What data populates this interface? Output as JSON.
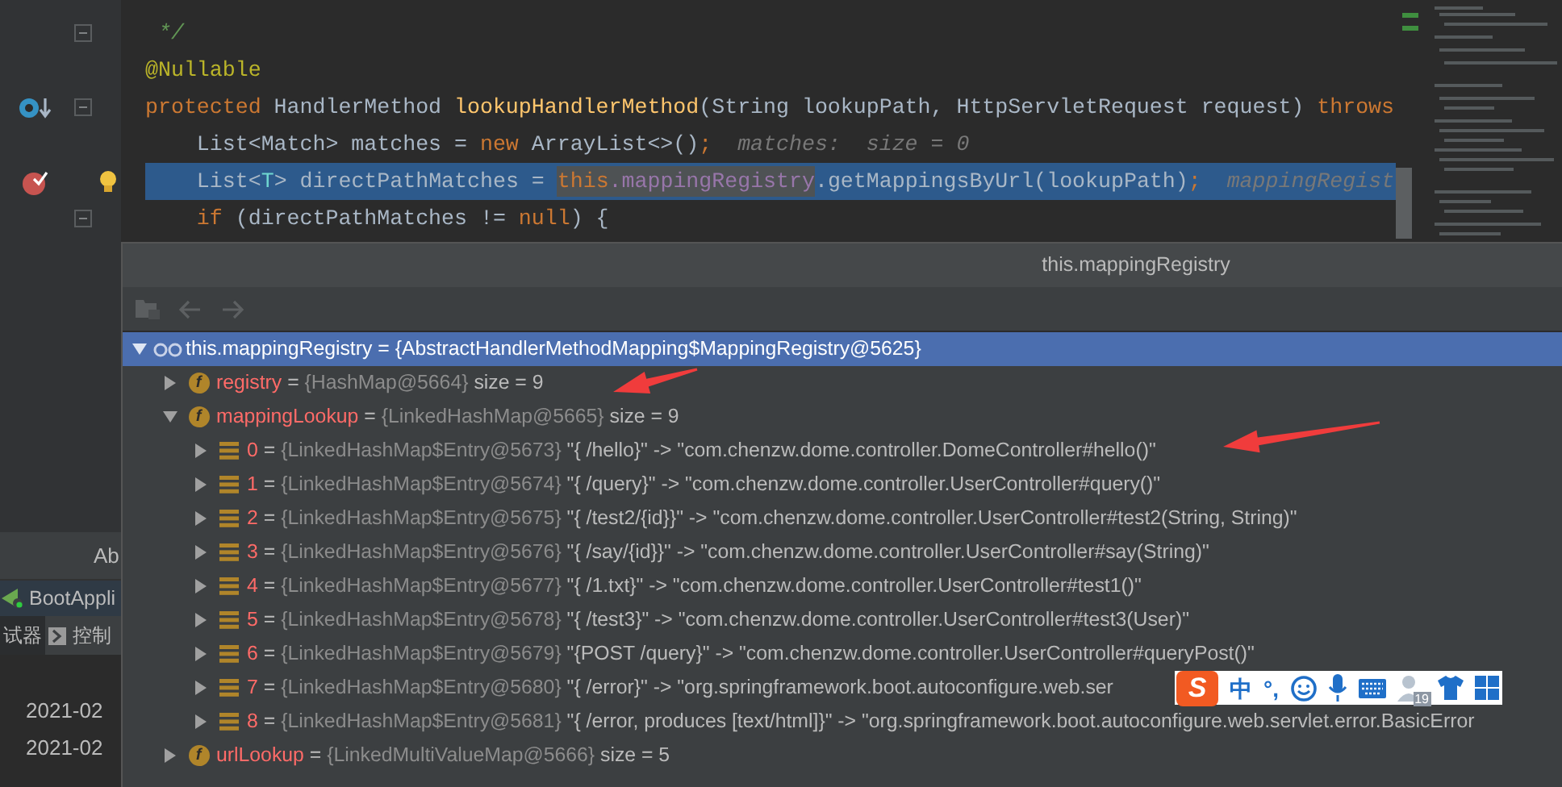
{
  "editor": {
    "lines": [
      {
        "kind": "plain",
        "fold": true,
        "bulb": false,
        "current": false,
        "tokens": [
          {
            "kind": "comment",
            "text": " */"
          }
        ]
      },
      {
        "kind": "plain",
        "fold": false,
        "bulb": false,
        "current": false,
        "tokens": [
          {
            "kind": "annotation",
            "text": "@Nullable"
          }
        ]
      },
      {
        "kind": "watch",
        "fold": true,
        "bulb": false,
        "current": false,
        "tokens": [
          {
            "kind": "keyword",
            "text": "protected "
          },
          {
            "kind": "plain",
            "text": "HandlerMethod "
          },
          {
            "kind": "method",
            "text": "lookupHandlerMethod"
          },
          {
            "kind": "plain",
            "text": "(String lookupPath, HttpServletRequest request) "
          },
          {
            "kind": "keyword",
            "text": "throws"
          }
        ]
      },
      {
        "kind": "plain",
        "fold": false,
        "bulb": false,
        "current": false,
        "tokens": [
          {
            "kind": "plain",
            "text": "    List<Match> matches = "
          },
          {
            "kind": "keyword",
            "text": "new "
          },
          {
            "kind": "plain",
            "text": "ArrayList<>()"
          },
          {
            "kind": "keyword",
            "text": ";"
          },
          {
            "kind": "hint",
            "text": "  matches:  size = 0"
          }
        ]
      },
      {
        "kind": "breakpoint",
        "fold": false,
        "bulb": true,
        "current": true,
        "tokens": [
          {
            "kind": "plain",
            "text": "    List<",
            "selected": false
          },
          {
            "kind": "typeparam",
            "text": "T",
            "selected": false
          },
          {
            "kind": "plain",
            "text": "> directPathMatches = ",
            "selected": false
          },
          {
            "kind": "keyword",
            "text": "this",
            "selected": true
          },
          {
            "kind": "field",
            "text": ".mappingRegistry",
            "selected": true
          },
          {
            "kind": "plain",
            "text": ".getMappingsByUrl(lookupPath)",
            "selected": false
          },
          {
            "kind": "keyword",
            "text": ";",
            "selected": false
          },
          {
            "kind": "hint",
            "text": "  mappingRegist",
            "selected": false
          }
        ]
      },
      {
        "kind": "plain",
        "fold": true,
        "bulb": false,
        "current": false,
        "tokens": [
          {
            "kind": "keyword",
            "text": "    if "
          },
          {
            "kind": "plain",
            "text": "(directPathMatches != "
          },
          {
            "kind": "keyword",
            "text": "null"
          },
          {
            "kind": "plain",
            "text": ") {"
          }
        ]
      }
    ]
  },
  "tool_panel": {
    "tab_label": "Ab",
    "run_tab": "BootAppli",
    "tabs": [
      {
        "label": "试器",
        "selected": true,
        "icon": false
      },
      {
        "label": "控制",
        "selected": false,
        "icon": true
      }
    ],
    "log_lines": [
      "2021-02",
      "2021-02"
    ]
  },
  "popup": {
    "title": "this.mappingRegistry",
    "tree": [
      {
        "kind": "watch",
        "name": "this.mappingRegistry",
        "sign": "=",
        "type": "{AbstractHandlerMethodMapping$MappingRegistry@5625}",
        "selected": true,
        "expanded": true,
        "children": [
          {
            "kind": "field",
            "badge": "f",
            "name": "registry",
            "sign": "=",
            "type": "{HashMap@5664}",
            "value": "size = 9",
            "selected": false,
            "expanded": false
          },
          {
            "kind": "field",
            "badge": "f",
            "name": "mappingLookup",
            "sign": "=",
            "type": "{LinkedHashMap@5665}",
            "value": "size = 9",
            "selected": false,
            "expanded": true,
            "children": [
              {
                "kind": "entry",
                "name": "0",
                "sign": "=",
                "type": "{LinkedHashMap$Entry@5673}",
                "value": "\"{ /hello}\" -> \"com.chenzw.dome.controller.DomeController#hello()\"",
                "selected": false,
                "expanded": false
              },
              {
                "kind": "entry",
                "name": "1",
                "sign": "=",
                "type": "{LinkedHashMap$Entry@5674}",
                "value": "\"{ /query}\" -> \"com.chenzw.dome.controller.UserController#query()\"",
                "selected": false,
                "expanded": false
              },
              {
                "kind": "entry",
                "name": "2",
                "sign": "=",
                "type": "{LinkedHashMap$Entry@5675}",
                "value": "\"{ /test2/{id}}\" -> \"com.chenzw.dome.controller.UserController#test2(String, String)\"",
                "selected": false,
                "expanded": false
              },
              {
                "kind": "entry",
                "name": "3",
                "sign": "=",
                "type": "{LinkedHashMap$Entry@5676}",
                "value": "\"{ /say/{id}}\" -> \"com.chenzw.dome.controller.UserController#say(String)\"",
                "selected": false,
                "expanded": false
              },
              {
                "kind": "entry",
                "name": "4",
                "sign": "=",
                "type": "{LinkedHashMap$Entry@5677}",
                "value": "\"{ /1.txt}\" -> \"com.chenzw.dome.controller.UserController#test1()\"",
                "selected": false,
                "expanded": false
              },
              {
                "kind": "entry",
                "name": "5",
                "sign": "=",
                "type": "{LinkedHashMap$Entry@5678}",
                "value": "\"{ /test3}\" -> \"com.chenzw.dome.controller.UserController#test3(User)\"",
                "selected": false,
                "expanded": false
              },
              {
                "kind": "entry",
                "name": "6",
                "sign": "=",
                "type": "{LinkedHashMap$Entry@5679}",
                "value": "\"{POST /query}\" -> \"com.chenzw.dome.controller.UserController#queryPost()\"",
                "selected": false,
                "expanded": false
              },
              {
                "kind": "entry",
                "name": "7",
                "sign": "=",
                "type": "{LinkedHashMap$Entry@5680}",
                "value": "\"{ /error}\" -> \"org.springframework.boot.autoconfigure.web.ser",
                "selected": false,
                "expanded": false
              },
              {
                "kind": "entry",
                "name": "8",
                "sign": "=",
                "type": "{LinkedHashMap$Entry@5681}",
                "value": "\"{ /error, produces [text/html]}\" -> \"org.springframework.boot.autoconfigure.web.servlet.error.BasicError",
                "selected": false,
                "expanded": false
              }
            ]
          },
          {
            "kind": "field",
            "badge": "f",
            "name": "urlLookup",
            "sign": "=",
            "type": "{LinkedMultiValueMap@5666}",
            "value": "size = 5",
            "selected": false,
            "expanded": false
          }
        ]
      }
    ]
  },
  "ime_toolbar": {
    "logo": "S",
    "mode": "中",
    "punctuation": "°,",
    "badge": "19"
  }
}
